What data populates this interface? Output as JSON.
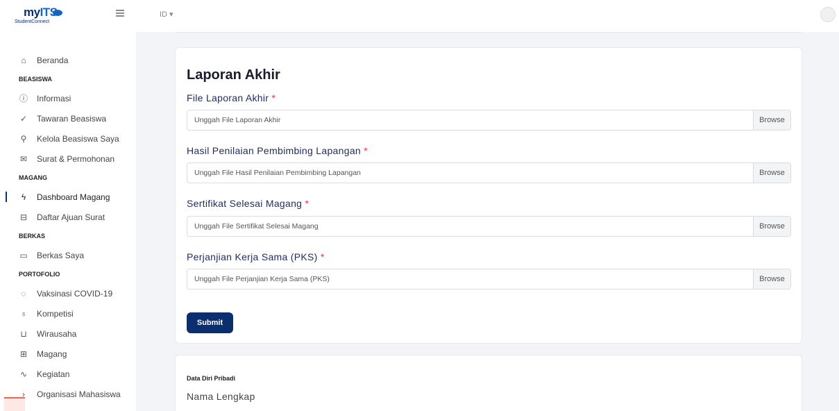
{
  "brand": {
    "name_prefix": "my",
    "name_suffix": "ITS",
    "tagline": "StudentConnect"
  },
  "topbar": {
    "language": "ID ▾"
  },
  "sidebar": {
    "items": [
      {
        "type": "item",
        "label": "Beranda",
        "icon": "home-icon",
        "glyph": "⌂"
      },
      {
        "type": "section",
        "label": "BEASISWA"
      },
      {
        "type": "item",
        "label": "Informasi",
        "icon": "info-icon",
        "glyph": "ⓘ"
      },
      {
        "type": "item",
        "label": "Tawaran Beasiswa",
        "icon": "check-circle-icon",
        "glyph": "✓"
      },
      {
        "type": "item",
        "label": "Kelola Beasiswa Saya",
        "icon": "user-icon",
        "glyph": "⚲"
      },
      {
        "type": "item",
        "label": "Surat & Permohonan",
        "icon": "mail-icon",
        "glyph": "✉"
      },
      {
        "type": "section",
        "label": "MAGANG"
      },
      {
        "type": "item",
        "label": "Dashboard Magang",
        "icon": "lightning-icon",
        "glyph": "ϟ",
        "active": true
      },
      {
        "type": "item",
        "label": "Daftar Ajuan Surat",
        "icon": "inbox-icon",
        "glyph": "⊟"
      },
      {
        "type": "section",
        "label": "BERKAS"
      },
      {
        "type": "item",
        "label": "Berkas Saya",
        "icon": "folder-icon",
        "glyph": "▭"
      },
      {
        "type": "section",
        "label": "PORTOFOLIO"
      },
      {
        "type": "item",
        "label": "Vaksinasi COVID-19",
        "icon": "droplet-icon",
        "glyph": "◌"
      },
      {
        "type": "item",
        "label": "Kompetisi",
        "icon": "award-icon",
        "glyph": "♁"
      },
      {
        "type": "item",
        "label": "Wirausaha",
        "icon": "cart-icon",
        "glyph": "⊔"
      },
      {
        "type": "item",
        "label": "Magang",
        "icon": "building-icon",
        "glyph": "⊞"
      },
      {
        "type": "item",
        "label": "Kegiatan",
        "icon": "activity-icon",
        "glyph": "∿"
      },
      {
        "type": "item",
        "label": "Organisasi Mahasiswa",
        "icon": "chevron-right-icon",
        "glyph": "›"
      }
    ]
  },
  "form": {
    "title": "Laporan Akhir",
    "required_marker": "*",
    "browse_label": "Browse",
    "fields": [
      {
        "label": "File Laporan Akhir",
        "placeholder": "Unggah File Laporan Akhir"
      },
      {
        "label": "Hasil Penilaian Pembimbing Lapangan",
        "placeholder": "Unggah File Hasil Penilaian Pembimbing Lapangan"
      },
      {
        "label": "Sertifikat Selesai Magang",
        "placeholder": "Unggah File Sertifikat Selesai Magang"
      },
      {
        "label": "Perjanjian Kerja Sama (PKS)",
        "placeholder": "Unggah File Perjanjian Kerja Sama (PKS)"
      }
    ],
    "submit_label": "Submit"
  },
  "personal_data": {
    "heading": "Data Diri Pribadi",
    "first_label": "Nama Lengkap"
  },
  "colors": {
    "primary": "#0a2e6e",
    "required": "#e0393e",
    "label": "#1f2a5c"
  }
}
